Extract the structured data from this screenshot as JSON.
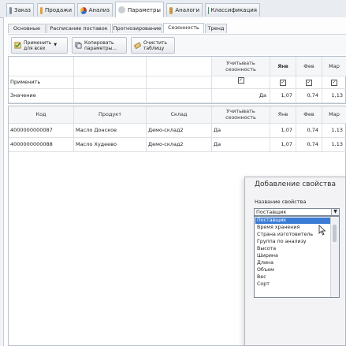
{
  "main_tabs": [
    {
      "label": "Заказ",
      "color": "#7a8aa0"
    },
    {
      "label": "Продажи",
      "color": "#e0a030"
    },
    {
      "label": "Анализ",
      "color": "#c0392b"
    },
    {
      "label": "Параметры",
      "color": "#9aa5b1"
    },
    {
      "label": "Аналоги",
      "color": "#c8963c"
    },
    {
      "label": "Классификация",
      "color": "#3c9a5a"
    }
  ],
  "sub_tabs": [
    "Основные",
    "Расписание поставок",
    "Прогнозирование",
    "Сезонность",
    "Тренд"
  ],
  "toolbar": {
    "apply_all": "Применить\nдля всех",
    "copy_params": "Копировать\nпараметры...",
    "clear_table": "Очистить\nтаблицу"
  },
  "top_grid": {
    "headers": {
      "seasonality": "Учитывать\nсезонность",
      "jan": "Янв",
      "feb": "Фев",
      "mar": "Мар"
    },
    "rows": [
      {
        "label": "Применить",
        "checks": [
          "✓",
          "✓",
          "✓",
          "✓"
        ]
      },
      {
        "label": "Значение",
        "values": [
          "Да",
          "1,07",
          "0,74",
          "1,13"
        ]
      }
    ]
  },
  "bottom_grid": {
    "headers": [
      "Код",
      "Продукт",
      "Склад",
      "Учитывать\nсезонность",
      "Янв",
      "Фев",
      "Мар"
    ],
    "rows": [
      [
        "4000000000087",
        "Масло Донское",
        "Демо-склад2",
        "Да",
        "1,07",
        "0,74",
        "1,13"
      ],
      [
        "4000000000088",
        "Масло Худеево",
        "Демо-склад2",
        "Да",
        "1,07",
        "0,74",
        "1,13"
      ]
    ]
  },
  "dialog": {
    "title": "Добавление свойства",
    "field_label": "Название свойства",
    "selected": "Поставщик",
    "options": [
      "Поставщик",
      "Время хранения",
      "Страна изготовитель",
      "Группа по анализу",
      "Высота",
      "Ширина",
      "Длина",
      "Объем",
      "Вес",
      "Сорт"
    ]
  }
}
